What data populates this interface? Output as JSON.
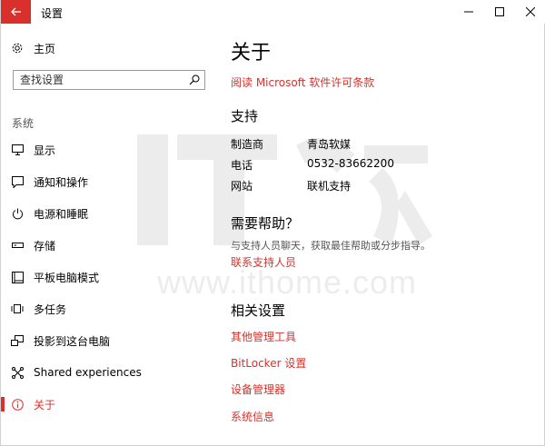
{
  "window": {
    "title": "设置"
  },
  "sidebar": {
    "home_label": "主页",
    "search_placeholder": "查找设置",
    "section_label": "系统",
    "items": [
      {
        "label": "显示",
        "icon": "monitor-icon"
      },
      {
        "label": "通知和操作",
        "icon": "notification-icon"
      },
      {
        "label": "电源和睡眠",
        "icon": "power-icon"
      },
      {
        "label": "存储",
        "icon": "storage-icon"
      },
      {
        "label": "平板电脑模式",
        "icon": "tablet-icon"
      },
      {
        "label": "多任务",
        "icon": "multitask-icon"
      },
      {
        "label": "投影到这台电脑",
        "icon": "project-icon"
      },
      {
        "label": "Shared experiences",
        "icon": "shared-icon"
      },
      {
        "label": "关于",
        "icon": "info-icon",
        "active": true
      }
    ]
  },
  "main": {
    "title": "关于",
    "license_link": "阅读 Microsoft 软件许可条款",
    "support": {
      "title": "支持",
      "rows": [
        {
          "label": "制造商",
          "value": "青岛软媒"
        },
        {
          "label": "电话",
          "value": "0532-83662200"
        },
        {
          "label": "网站",
          "value": "联机支持"
        }
      ]
    },
    "help": {
      "title": "需要帮助？",
      "text": "与支持人员聊天，获取最佳帮助或分步指导。",
      "link": "联系支持人员"
    },
    "related": {
      "title": "相关设置",
      "links": [
        "其他管理工具",
        "BitLocker 设置",
        "设备管理器",
        "系统信息"
      ]
    }
  },
  "watermark": {
    "text": "www.ithome.com"
  },
  "colors": {
    "accent": "#d9302b"
  }
}
